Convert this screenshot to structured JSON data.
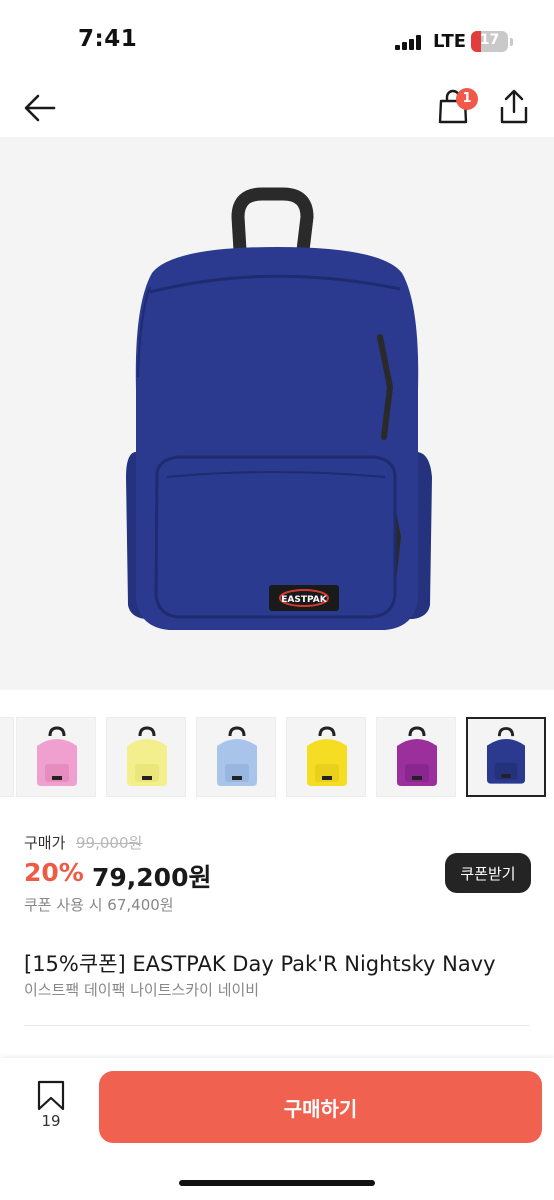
{
  "status_bar": {
    "time": "7:41",
    "network": "LTE",
    "battery": "17"
  },
  "nav": {
    "back_icon": "arrow-left-icon",
    "bag_icon": "shopping-bag-icon",
    "cart_count": "1",
    "share_icon": "share-icon"
  },
  "hero": {
    "brand_label": "EASTPAK",
    "bag_color": "#2b3a8f"
  },
  "thumbnails": [
    {
      "color": "#2b3a8f",
      "name": "navy"
    },
    {
      "color": "#f0a0cf",
      "name": "pink"
    },
    {
      "color": "#f3ef8c",
      "name": "light-yellow"
    },
    {
      "color": "#a9c4ea",
      "name": "light-blue"
    },
    {
      "color": "#f5dd24",
      "name": "yellow"
    },
    {
      "color": "#9b2f9c",
      "name": "purple"
    },
    {
      "color": "#2b3a8f",
      "name": "navy-selected"
    }
  ],
  "price": {
    "label": "구매가",
    "original": "99,000원",
    "discount_rate": "20%",
    "sale_price": "79,200원",
    "coupon_price": "쿠폰 사용 시 67,400원",
    "coupon_button": "쿠폰받기"
  },
  "product": {
    "title": "[15%쿠폰] EASTPAK Day Pak'R Nightsky Navy",
    "subtitle": "이스트팩 데이팩 나이트스카이 네이비"
  },
  "bottom": {
    "bookmark_count": "19",
    "buy_label": "구매하기"
  },
  "colors": {
    "accent": "#f06150",
    "discount": "#ee5a44",
    "badge": "#f0584a"
  }
}
